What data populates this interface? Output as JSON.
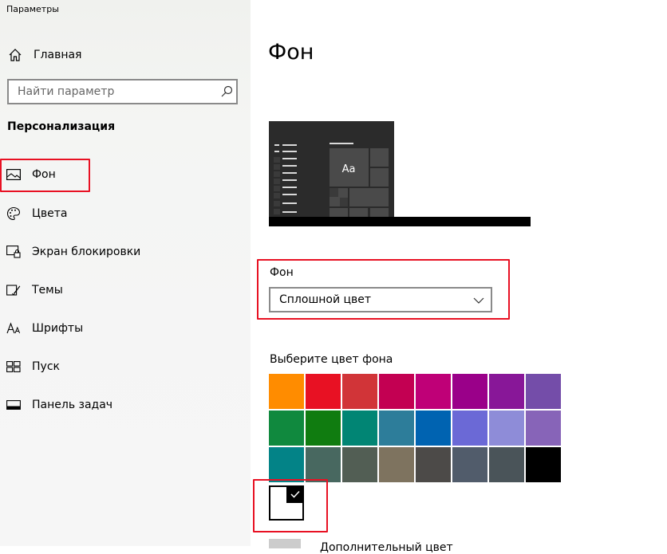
{
  "window": {
    "title": "Параметры"
  },
  "sidebar": {
    "home_label": "Главная",
    "search_placeholder": "Найти параметр",
    "section_title": "Персонализация",
    "items": [
      {
        "label": "Фон",
        "icon": "picture-icon"
      },
      {
        "label": "Цвета",
        "icon": "palette-icon"
      },
      {
        "label": "Экран блокировки",
        "icon": "lock-screen-icon"
      },
      {
        "label": "Темы",
        "icon": "themes-icon"
      },
      {
        "label": "Шрифты",
        "icon": "fonts-icon"
      },
      {
        "label": "Пуск",
        "icon": "start-icon"
      },
      {
        "label": "Панель задач",
        "icon": "taskbar-icon"
      }
    ]
  },
  "main": {
    "title": "Фон",
    "preview": {
      "tile_text": "Aa"
    },
    "background": {
      "label": "Фон",
      "value": "Сплошной цвет"
    },
    "color_picker": {
      "label": "Выберите цвет фона",
      "colors": [
        "#ff8c00",
        "#e81123",
        "#d13438",
        "#c30052",
        "#bf0077",
        "#9a0089",
        "#881798",
        "#744da9",
        "#10893e",
        "#107c10",
        "#018574",
        "#2d7d9a",
        "#0063b1",
        "#6b69d6",
        "#8e8cd8",
        "#8764b8",
        "#038387",
        "#486860",
        "#525e54",
        "#7e735f",
        "#4c4a48",
        "#515c6b",
        "#4a5459",
        "#000000"
      ],
      "selected_custom": "#ffffff"
    },
    "additional_color_label": "Дополнительный цвет"
  },
  "accent": {
    "highlight": "#e81123"
  }
}
